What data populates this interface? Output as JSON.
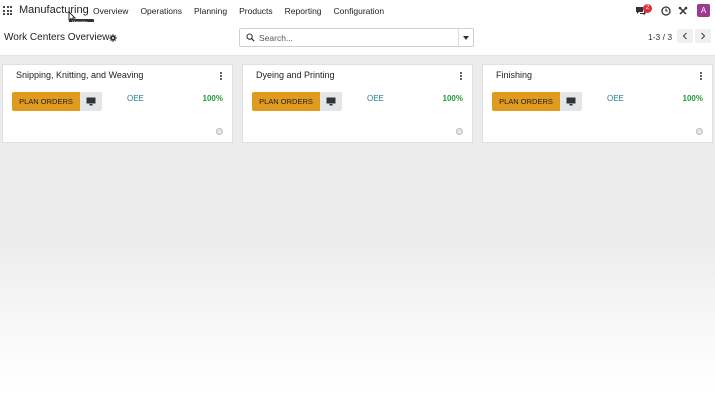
{
  "navbar": {
    "app_name": "Manufacturing",
    "menu": [
      "Overview",
      "Operations",
      "Planning",
      "Products",
      "Reporting",
      "Configuration"
    ],
    "tooltip": "Manufac...",
    "chat_count": "2",
    "user_initial": "A",
    "icons": [
      "apps-icon",
      "chat-icon",
      "clock-icon",
      "tools-icon"
    ]
  },
  "control_panel": {
    "title": "Work Centers Overview",
    "search_placeholder": "Search...",
    "pager": "1-3 / 3"
  },
  "work_centers": [
    {
      "name": "Snipping, Knitting, and Weaving",
      "plan_label": "PLAN ORDERS",
      "oee_label": "OEE",
      "oee_value": "100%"
    },
    {
      "name": "Dyeing and Printing",
      "plan_label": "PLAN ORDERS",
      "oee_label": "OEE",
      "oee_value": "100%"
    },
    {
      "name": "Finishing",
      "plan_label": "PLAN ORDERS",
      "oee_label": "OEE",
      "oee_value": "100%"
    }
  ],
  "colors": {
    "accent": "#e09b1f",
    "oee_label": "#1a7f8f",
    "oee_value": "#1e9b3a",
    "avatar": "#9b3a8e",
    "badge": "#e0303e"
  }
}
